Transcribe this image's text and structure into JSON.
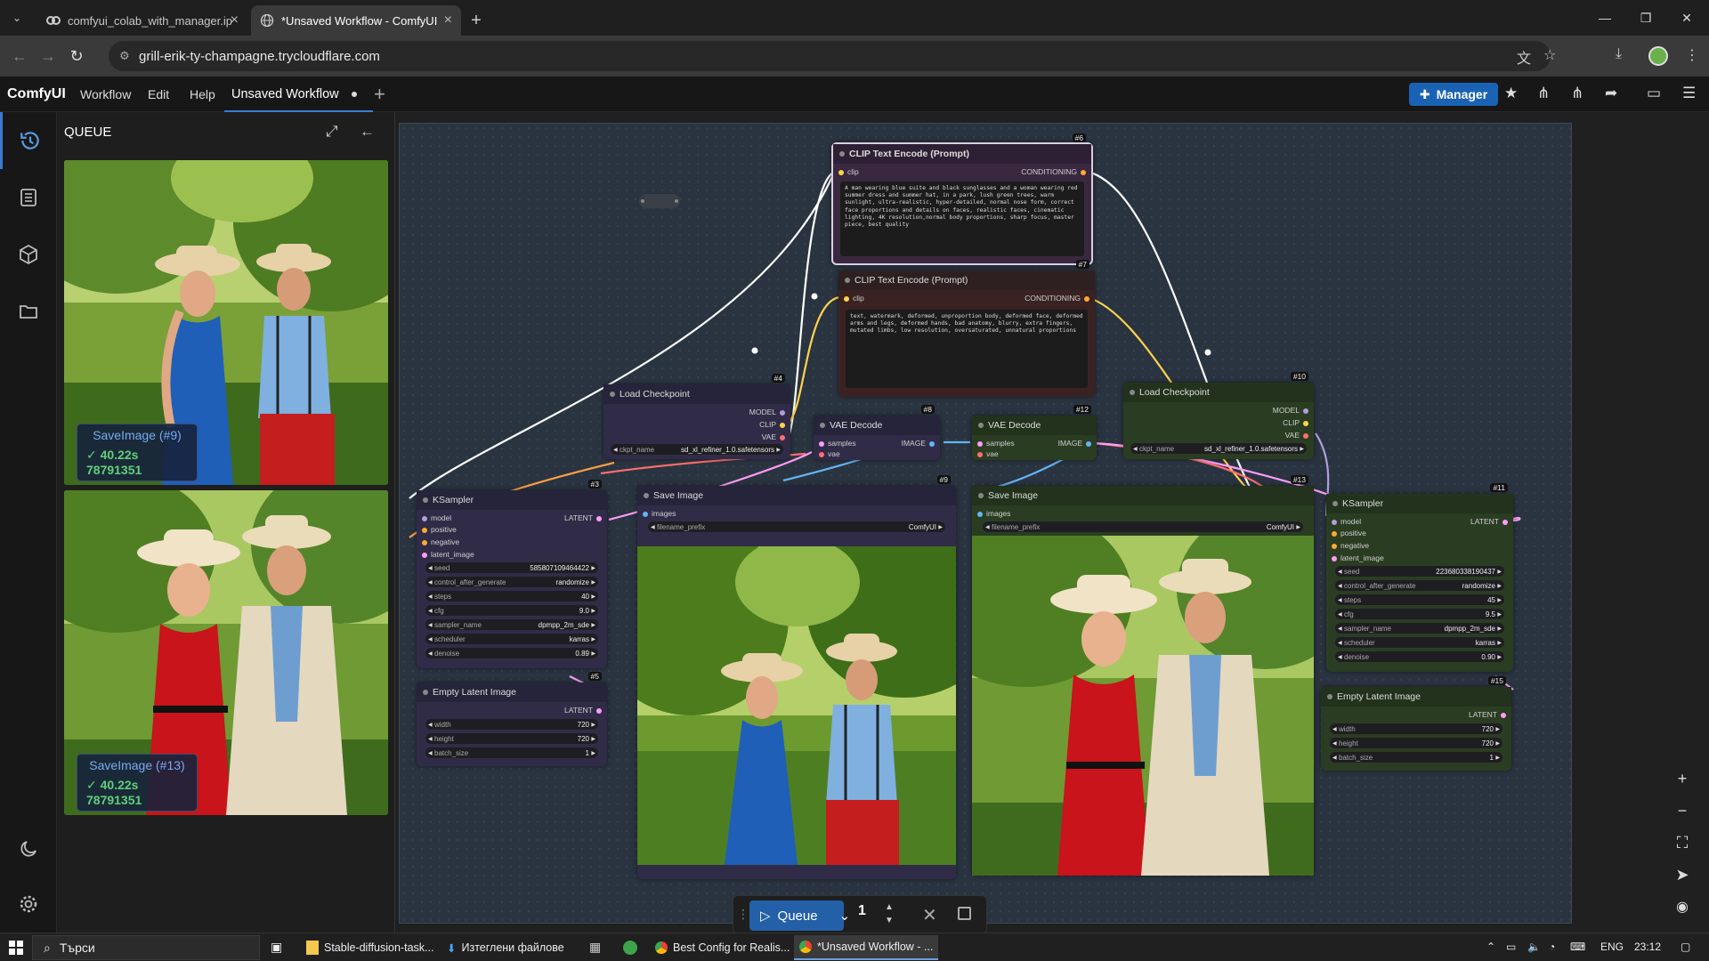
{
  "browser": {
    "tabs": [
      {
        "title": "comfyui_colab_with_manager.ip",
        "active": false
      },
      {
        "title": "*Unsaved Workflow - ComfyUI",
        "active": true
      }
    ],
    "url": "grill-erik-ty-champagne.trycloudflare.com"
  },
  "menubar": {
    "brand": "ComfyUI",
    "items": [
      "Workflow",
      "Edit",
      "Help"
    ],
    "workflow_tab": "Unsaved Workflow",
    "manager_label": "Manager"
  },
  "queue_panel": {
    "title": "QUEUE",
    "items": [
      {
        "name": "SaveImage (#9)",
        "time": "40.22s 78791351",
        "variant": "blue-dress"
      },
      {
        "name": "SaveImage (#13)",
        "time": "40.22s 78791351",
        "variant": "red-dress"
      }
    ]
  },
  "nodes": {
    "clip6": {
      "id": "#6",
      "title": "CLIP Text Encode (Prompt)",
      "input": "clip",
      "output": "CONDITIONING",
      "text": "A man wearing blue suite and black sunglasses and a woman wearing red summer dress and summer hat, in a park, lush green trees, warm sunlight, ultra-realistic, hyper-detailed, normal nose form, correct face proportions and details on faces, realistic faces, cinematic lighting, 4K resolution,normal body proportions, sharp focus, master piece, best quality"
    },
    "clip7": {
      "id": "#7",
      "title": "CLIP Text Encode (Prompt)",
      "input": "clip",
      "output": "CONDITIONING",
      "text": "text, watermark, deformed, unproportion body, deformed face, deformed arms and legs, deformed hands, bad anatomy, blurry, extra fingers, mutated limbs, low resolution, oversaturated, unnatural proportions"
    },
    "ckpt4": {
      "id": "#4",
      "title": "Load Checkpoint",
      "outputs": [
        "MODEL",
        "CLIP",
        "VAE"
      ],
      "widget_label": "ckpt_name",
      "widget_value": "sd_xl_refiner_1.0.safetensors"
    },
    "ckpt10": {
      "id": "#10",
      "title": "Load Checkpoint",
      "outputs": [
        "MODEL",
        "CLIP",
        "VAE"
      ],
      "widget_label": "ckpt_name",
      "widget_value": "sd_xl_refiner_1.0.safetensors"
    },
    "vae8": {
      "id": "#8",
      "title": "VAE Decode",
      "inputs": [
        "samples",
        "vae"
      ],
      "output": "IMAGE"
    },
    "vae12": {
      "id": "#12",
      "title": "VAE Decode",
      "inputs": [
        "samples",
        "vae"
      ],
      "output": "IMAGE"
    },
    "ks3": {
      "id": "#3",
      "title": "KSampler",
      "inputs": [
        "model",
        "positive",
        "negative",
        "latent_image"
      ],
      "output": "LATENT",
      "widgets": [
        {
          "label": "seed",
          "value": "585807109464422"
        },
        {
          "label": "control_after_generate",
          "value": "randomize"
        },
        {
          "label": "steps",
          "value": "40"
        },
        {
          "label": "cfg",
          "value": "9.0"
        },
        {
          "label": "sampler_name",
          "value": "dpmpp_2m_sde"
        },
        {
          "label": "scheduler",
          "value": "karras"
        },
        {
          "label": "denoise",
          "value": "0.89"
        }
      ]
    },
    "ks11": {
      "id": "#11",
      "title": "KSampler",
      "inputs": [
        "model",
        "positive",
        "negative",
        "latent_image"
      ],
      "output": "LATENT",
      "widgets": [
        {
          "label": "seed",
          "value": "223680338190437"
        },
        {
          "label": "control_after_generate",
          "value": "randomize"
        },
        {
          "label": "steps",
          "value": "45"
        },
        {
          "label": "cfg",
          "value": "9.5"
        },
        {
          "label": "sampler_name",
          "value": "dpmpp_2m_sde"
        },
        {
          "label": "scheduler",
          "value": "karras"
        },
        {
          "label": "denoise",
          "value": "0.90"
        }
      ]
    },
    "lat5": {
      "id": "#5",
      "title": "Empty Latent Image",
      "output": "LATENT",
      "widgets": [
        {
          "label": "width",
          "value": "720"
        },
        {
          "label": "height",
          "value": "720"
        },
        {
          "label": "batch_size",
          "value": "1"
        }
      ]
    },
    "lat15": {
      "id": "#15",
      "title": "Empty Latent Image",
      "output": "LATENT",
      "widgets": [
        {
          "label": "width",
          "value": "720"
        },
        {
          "label": "height",
          "value": "720"
        },
        {
          "label": "batch_size",
          "value": "1"
        }
      ]
    },
    "save9": {
      "id": "#9",
      "title": "Save Image",
      "input": "images",
      "widget_label": "filename_prefix",
      "widget_value": "ComfyUI"
    },
    "save13": {
      "id": "#13",
      "title": "Save Image",
      "input": "images",
      "widget_label": "filename_prefix",
      "widget_value": "ComfyUI"
    }
  },
  "queue_bar": {
    "label": "Queue",
    "count": "1"
  },
  "taskbar": {
    "search_placeholder": "Търси",
    "apps": [
      "Stable-diffusion-task...",
      "Изтеглени файлове",
      "Best Config for Realis...",
      "*Unsaved Workflow - ..."
    ],
    "lang": "ENG",
    "time": "23:12"
  },
  "colors": {
    "accent": "#2360a8",
    "clip_wire": "#ffd34d",
    "model_wire": "#b39ddb",
    "vae_wire": "#ff6e6e",
    "latent_wire": "#ff9cf9",
    "image_wire": "#64b5f6"
  }
}
